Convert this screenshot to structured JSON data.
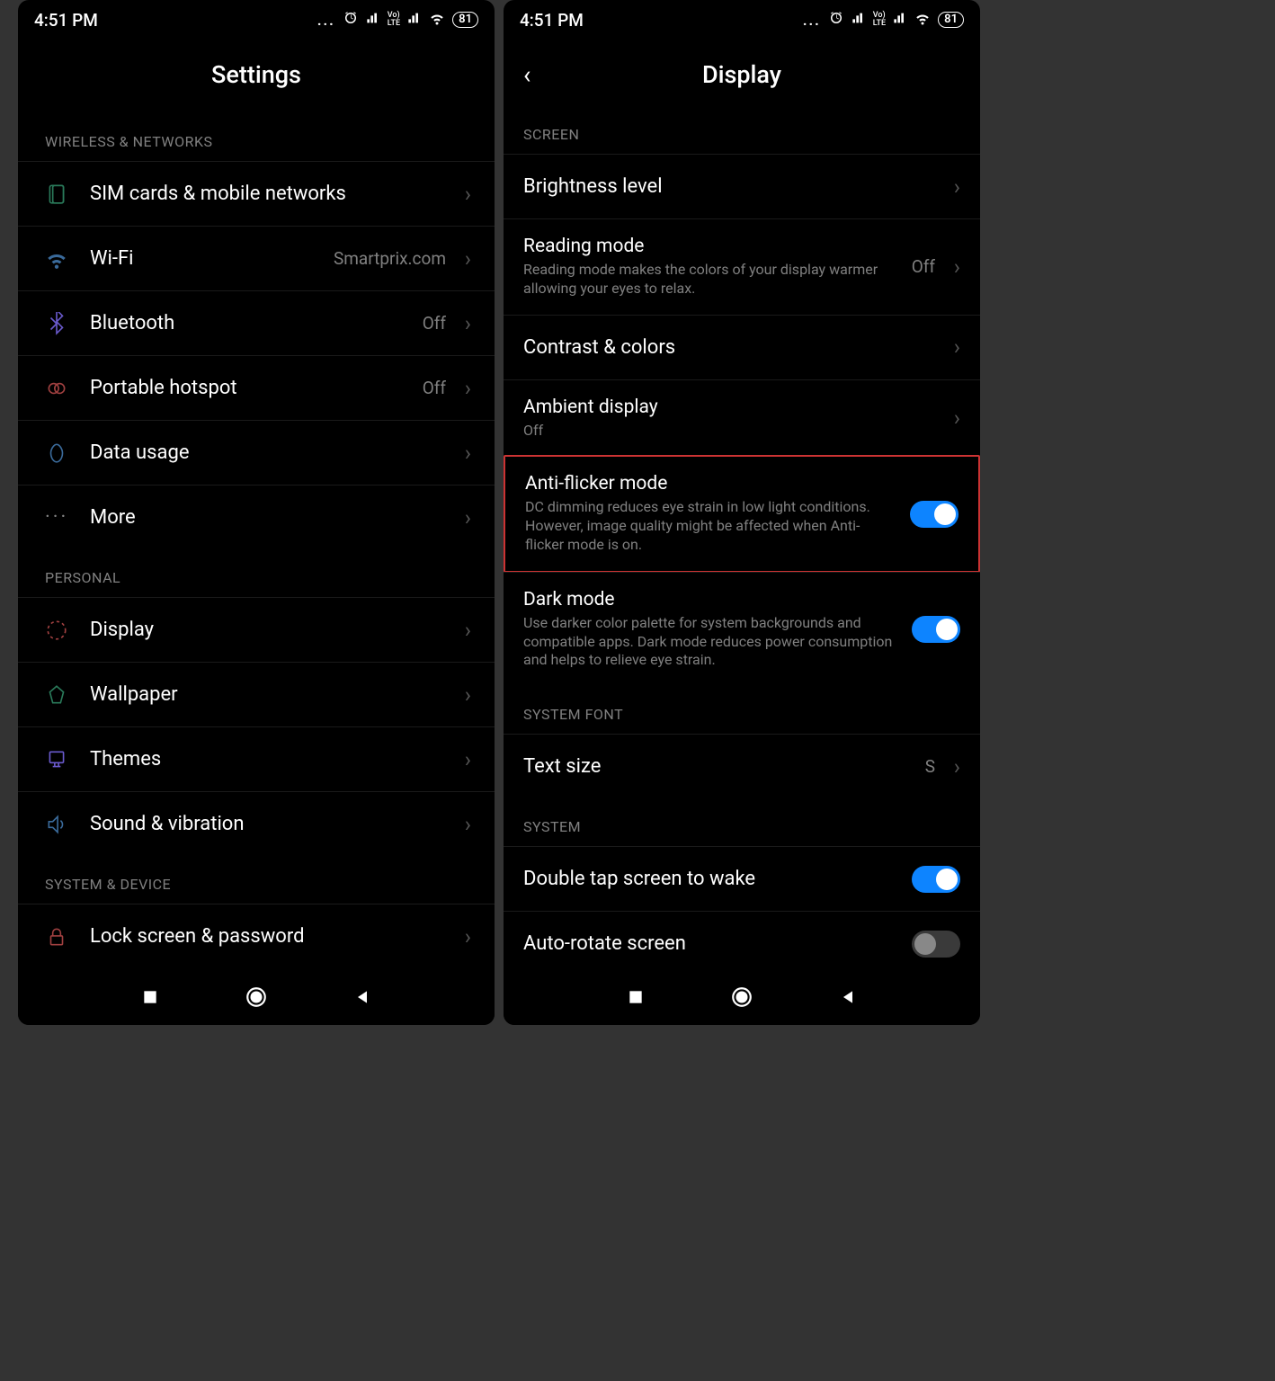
{
  "statusbar": {
    "time": "4:51 PM",
    "battery": "81",
    "lte_top": "Vo)",
    "lte_bot": "LTE"
  },
  "left": {
    "title": "Settings",
    "sections": {
      "wireless": {
        "header": "WIRELESS & NETWORKS",
        "sim": "SIM cards & mobile networks",
        "wifi": "Wi-Fi",
        "wifi_value": "Smartprix.com",
        "bluetooth": "Bluetooth",
        "bluetooth_value": "Off",
        "hotspot": "Portable hotspot",
        "hotspot_value": "Off",
        "data": "Data usage",
        "more": "More"
      },
      "personal": {
        "header": "PERSONAL",
        "display": "Display",
        "wallpaper": "Wallpaper",
        "themes": "Themes",
        "sound": "Sound & vibration"
      },
      "system": {
        "header": "SYSTEM & DEVICE",
        "lock": "Lock screen & password"
      }
    }
  },
  "right": {
    "title": "Display",
    "sections": {
      "screen": {
        "header": "SCREEN",
        "brightness": "Brightness level",
        "reading_title": "Reading mode",
        "reading_desc": "Reading mode makes the colors of your display warmer allowing your eyes to relax.",
        "reading_value": "Off",
        "contrast": "Contrast & colors",
        "ambient_title": "Ambient display",
        "ambient_desc": "Off",
        "antiflicker_title": "Anti-flicker mode",
        "antiflicker_desc": "DC dimming reduces eye strain in low light conditions. However, image quality might be affected when Anti-flicker mode is on.",
        "dark_title": "Dark mode",
        "dark_desc": "Use darker color palette for system backgrounds and compatible apps. Dark mode reduces power consumption and helps to relieve eye strain."
      },
      "font": {
        "header": "SYSTEM FONT",
        "textsize": "Text size",
        "textsize_value": "S"
      },
      "system": {
        "header": "SYSTEM",
        "doubletap": "Double tap screen to wake",
        "autorotate": "Auto-rotate screen"
      }
    }
  }
}
